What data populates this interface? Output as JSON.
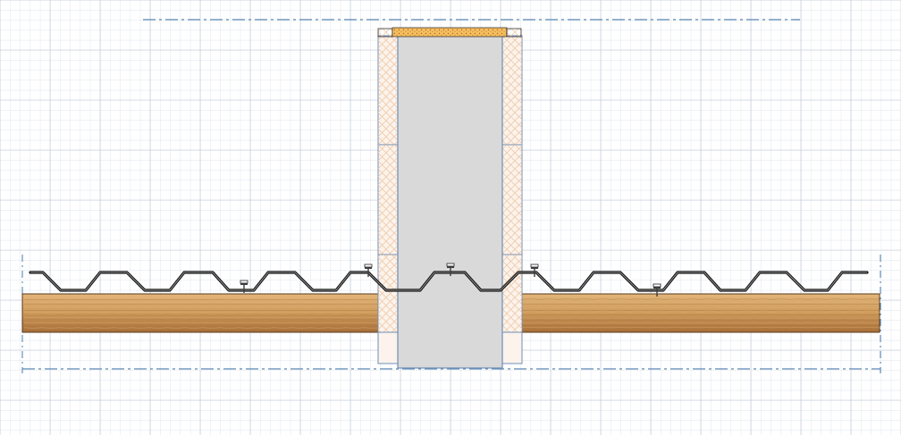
{
  "canvas": {
    "background": "#ffffff"
  },
  "colors": {
    "grid_minor": "#d4dce6",
    "grid_major": "#b9c6d4",
    "centerline": "#5b86b5",
    "wood_base": "#cd9a5a",
    "wood_dark": "#a8703a",
    "wood_light": "#e2b57a",
    "column_fill": "#d9d9d9",
    "column_outline": "#6f8fb8",
    "insulation_fill": "#fbf3ec",
    "insulation_hatch": "#f0c9a8",
    "insulation_outline": "#6f8fb8",
    "cap_fill": "#f3c15e",
    "cap_dots": "#c0562f",
    "sheet_stroke": "#1b1b1b",
    "fastener": "#3c3c3c"
  },
  "elements": {
    "beam_left": "timber-beam",
    "beam_right": "timber-beam",
    "column": "concrete-column",
    "insulation": "insulation-panel",
    "cap": "column-cap",
    "sheet": "trapezoidal-sheet",
    "fastener": "screw-fastener",
    "centerline": "axis-line"
  }
}
